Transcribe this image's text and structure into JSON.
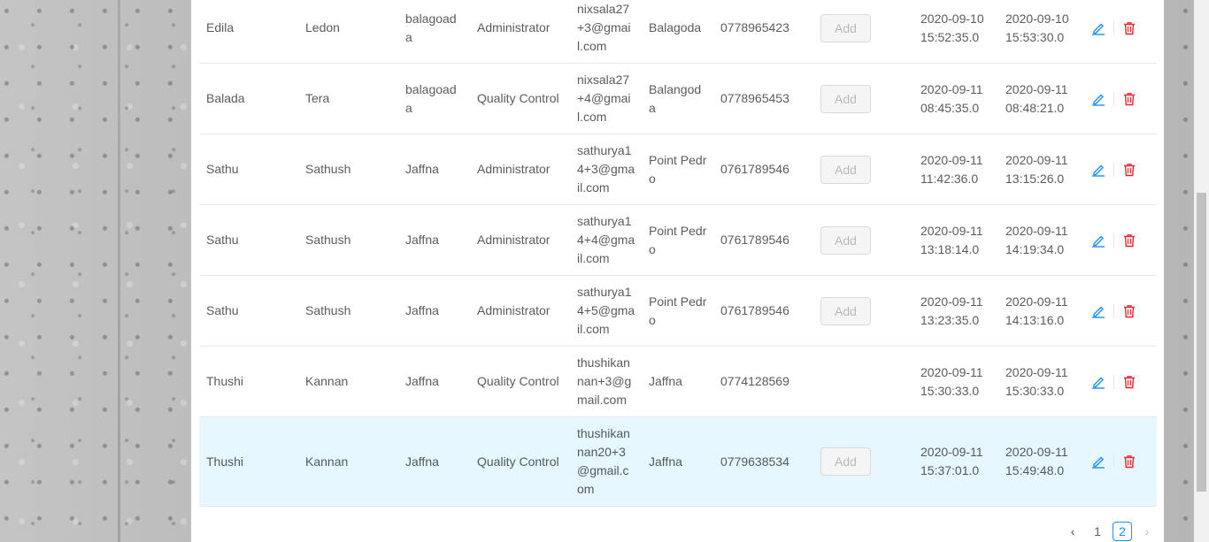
{
  "rows": [
    {
      "first": "Edila",
      "last": "Ledon",
      "city": "balagoada",
      "role": "Administrator",
      "email": "nixsala27+3@gmail.com",
      "address": "Balagoda",
      "phone": "0778965423",
      "button": "Add",
      "created": "2020-09-10 15:52:35.0",
      "updated": "2020-09-10 15:53:30.0",
      "has_button": true
    },
    {
      "first": "Balada",
      "last": "Tera",
      "city": "balagoada",
      "role": "Quality Control",
      "email": "nixsala27+4@gmail.com",
      "address": "Balangoda",
      "phone": "0778965453",
      "button": "Add",
      "created": "2020-09-11 08:45:35.0",
      "updated": "2020-09-11 08:48:21.0",
      "has_button": true
    },
    {
      "first": "Sathu",
      "last": "Sathush",
      "city": "Jaffna",
      "role": "Administrator",
      "email": "sathurya14+3@gmail.com",
      "address": "Point Pedro",
      "phone": "0761789546",
      "button": "Add",
      "created": "2020-09-11 11:42:36.0",
      "updated": "2020-09-11 13:15:26.0",
      "has_button": true
    },
    {
      "first": "Sathu",
      "last": "Sathush",
      "city": "Jaffna",
      "role": "Administrator",
      "email": "sathurya14+4@gmail.com",
      "address": "Point Pedro",
      "phone": "0761789546",
      "button": "Add",
      "created": "2020-09-11 13:18:14.0",
      "updated": "2020-09-11 14:19:34.0",
      "has_button": true
    },
    {
      "first": "Sathu",
      "last": "Sathush",
      "city": "Jaffna",
      "role": "Administrator",
      "email": "sathurya14+5@gmail.com",
      "address": "Point Pedro",
      "phone": "0761789546",
      "button": "Add",
      "created": "2020-09-11 13:23:35.0",
      "updated": "2020-09-11 14:13:16.0",
      "has_button": true
    },
    {
      "first": "Thushi",
      "last": "Kannan",
      "city": "Jaffna",
      "role": "Quality Control",
      "email": "thushikannan+3@gmail.com",
      "address": "Jaffna",
      "phone": "0774128569",
      "button": "",
      "created": "2020-09-11 15:30:33.0",
      "updated": "2020-09-11 15:30:33.0",
      "has_button": false
    },
    {
      "first": "Thushi",
      "last": "Kannan",
      "city": "Jaffna",
      "role": "Quality Control",
      "email": "thushikannan20+3@gmail.com",
      "address": "Jaffna",
      "phone": "0779638534",
      "button": "Add",
      "created": "2020-09-11 15:37:01.0",
      "updated": "2020-09-11 15:49:48.0",
      "has_button": true
    }
  ],
  "pagination": {
    "prev": "‹",
    "pages": [
      "1",
      "2"
    ],
    "current": "2",
    "next": "›"
  },
  "icons": {
    "edit": "edit-icon",
    "delete": "delete-icon"
  },
  "colors": {
    "link": "#1890ff",
    "danger": "#f5222d",
    "highlight": "#e6f7ff"
  }
}
